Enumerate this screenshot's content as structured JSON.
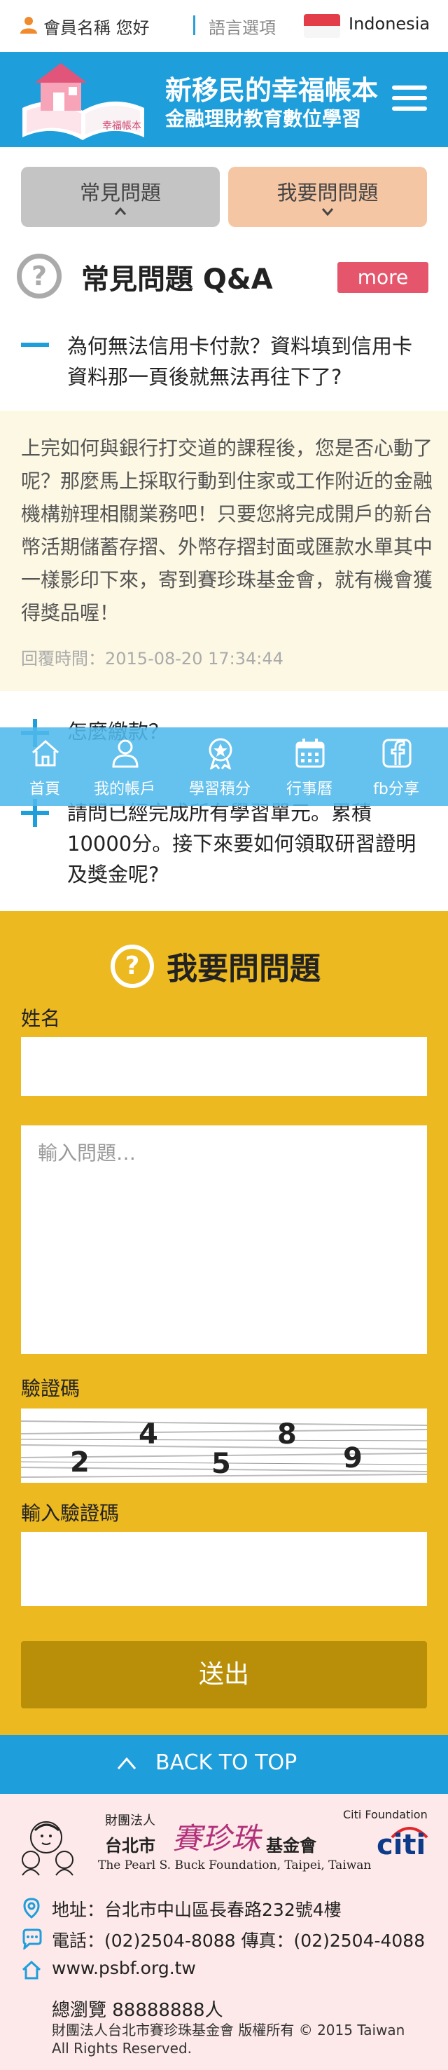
{
  "topbar": {
    "member_label": "會員名稱 您好",
    "language_label": "語言選項",
    "country": "Indonesia",
    "accent_color": "#1e9edb"
  },
  "header": {
    "logo_title": "新移民的幸福帳本",
    "logo_subtitle": "金融理財教育數位學習",
    "logo_book_text": "幸福帳本",
    "menu_icon": "hamburger-icon"
  },
  "tabs": [
    {
      "label": "常見問題",
      "icon": "chevron-up-icon"
    },
    {
      "label": "我要問問題",
      "icon": "chevron-down-icon"
    }
  ],
  "faq": {
    "title": "常見問題 Q&A",
    "more_label": "more",
    "items": [
      {
        "question": "為何無法信用卡付款？資料填到信用卡資料那一頁後就無法再往下了?",
        "toggle": "minus-icon",
        "answer": "上完如何與銀行打交道的課程後，您是否心動了呢？那麼馬上採取行動到住家或工作附近的金融機構辦理相關業務吧！只要您將完成開戶的新台幣活期儲蓄存摺、外幣存摺封面或匯款水單其中一樣影印下來，寄到賽珍珠基金會，就有機會獲得獎品喔！",
        "reply_time": "回覆時間：2015-08-20 17:34:44"
      },
      {
        "question": "怎麼繳款？",
        "toggle": "plus-icon"
      },
      {
        "question": "請問已經完成所有學習單元。累積10000分。接下來要如何領取研習證明及獎金呢?",
        "toggle": "plus-icon"
      }
    ]
  },
  "bottom_nav": [
    {
      "label": "首頁",
      "icon": "home-icon"
    },
    {
      "label": "我的帳戶",
      "icon": "user-icon"
    },
    {
      "label": "學習積分",
      "icon": "badge-icon"
    },
    {
      "label": "行事曆",
      "icon": "calendar-icon"
    },
    {
      "label": "fb分享",
      "icon": "facebook-icon"
    }
  ],
  "ask": {
    "title": "我要問問題",
    "name_label": "姓名",
    "question_placeholder": "輸入問題…",
    "captcha_label": "驗證碼",
    "captcha_digits": [
      "2",
      "4",
      "5",
      "8",
      "9"
    ],
    "captcha_input_label": "輸入驗證碼",
    "submit_label": "送出",
    "bg_color": "#ecb921"
  },
  "back_to_top": "BACK TO TOP",
  "footer": {
    "foundation_prefix": "財團法人",
    "foundation_city": "台北市",
    "foundation_brand": "賽珍珠",
    "foundation_suffix": "基金會",
    "foundation_en": "The Pearl S. Buck Foundation, Taipei, Taiwan",
    "citi_foundation": "Citi Foundation",
    "citi_logo": "citi",
    "address": "地址：台北市中山區長春路232號4樓",
    "phone": "電話：(02)2504-8088  傳真：(02)2504-4088",
    "website": "www.psbf.org.tw",
    "visits": "總瀏覽 88888888人",
    "copyright": "財團法人台北市賽珍珠基金會 版權所有 © 2015 Taiwan All Rights Reserved."
  }
}
